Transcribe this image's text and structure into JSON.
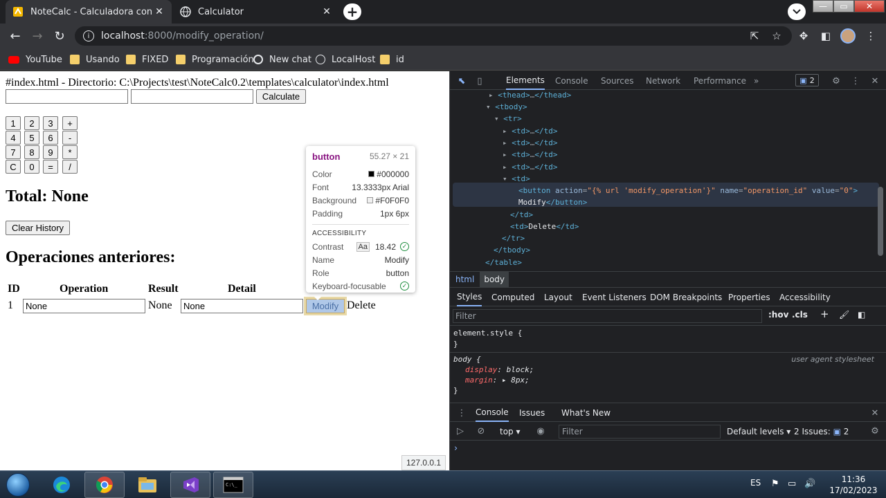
{
  "browser": {
    "tabs": [
      {
        "title": "NoteCalc - Calculadora con anot",
        "active": true
      },
      {
        "title": "Calculator",
        "active": false
      }
    ],
    "url_host": "localhost",
    "url_path": ":8000/modify_operation/",
    "bookmarks": [
      "YouTube",
      "Usando",
      "FIXED",
      "Programación",
      "New chat",
      "LocalHost",
      "id"
    ]
  },
  "page": {
    "file_comment": "#index.html - Directorio: C:\\Projects\\test\\NoteCalc0.2\\templates\\calculator\\index.html",
    "calculate_label": "Calculate",
    "keypad": [
      [
        "1",
        "2",
        "3",
        "+"
      ],
      [
        "4",
        "5",
        "6",
        "-"
      ],
      [
        "7",
        "8",
        "9",
        "*"
      ],
      [
        "C",
        "0",
        "=",
        "/"
      ]
    ],
    "total_text": "Total: None",
    "clear_history_label": "Clear History",
    "history_heading": "Operaciones anteriores:",
    "table_headers": [
      "ID",
      "Operation",
      "Result",
      "Detail"
    ],
    "row": {
      "id": "1",
      "operation": "None",
      "result": "None",
      "detail": "None",
      "modify_label": "Modify",
      "delete_label": "Delete"
    },
    "status_url": "127.0.0.1"
  },
  "inspector_tooltip": {
    "tag": "button",
    "dimensions": "55.27 × 21",
    "rows": [
      {
        "k": "Color",
        "v": "#000000",
        "swatch": "#000000"
      },
      {
        "k": "Font",
        "v": "13.3333px Arial"
      },
      {
        "k": "Background",
        "v": "#F0F0F0",
        "swatch": "#F0F0F0"
      },
      {
        "k": "Padding",
        "v": "1px 6px"
      }
    ],
    "accessibility_heading": "ACCESSIBILITY",
    "contrast_label": "Contrast",
    "contrast_aa": "Aa",
    "contrast_value": "18.42",
    "name_label": "Name",
    "name_value": "Modify",
    "role_label": "Role",
    "role_value": "button",
    "keyboard_label": "Keyboard-focusable"
  },
  "devtools": {
    "tabs": [
      "Elements",
      "Console",
      "Sources",
      "Network",
      "Performance"
    ],
    "more": "»",
    "issues_count": "2",
    "breadcrumbs": [
      "html",
      "body"
    ],
    "sub_tabs": [
      "Styles",
      "Computed",
      "Layout",
      "Event Listeners",
      "DOM Breakpoints",
      "Properties",
      "Accessibility"
    ],
    "filter_placeholder": "Filter",
    "hov": ":hov",
    "cls": ".cls",
    "element_style": "element.style {",
    "close_brace": "}",
    "body_selector": "body {",
    "ua_label": "user agent stylesheet",
    "prop_display": "display",
    "val_display": "block;",
    "prop_margin": "margin",
    "val_margin": "8px;",
    "drawer_tabs": [
      "Console",
      "Issues",
      "What's New"
    ],
    "context": "top",
    "console_filter": "Filter",
    "levels": "Default levels",
    "issues_label": "2 Issues:",
    "issues_num": "2"
  },
  "taskbar": {
    "lang": "ES",
    "time": "11:36",
    "date": "17/02/2023"
  }
}
